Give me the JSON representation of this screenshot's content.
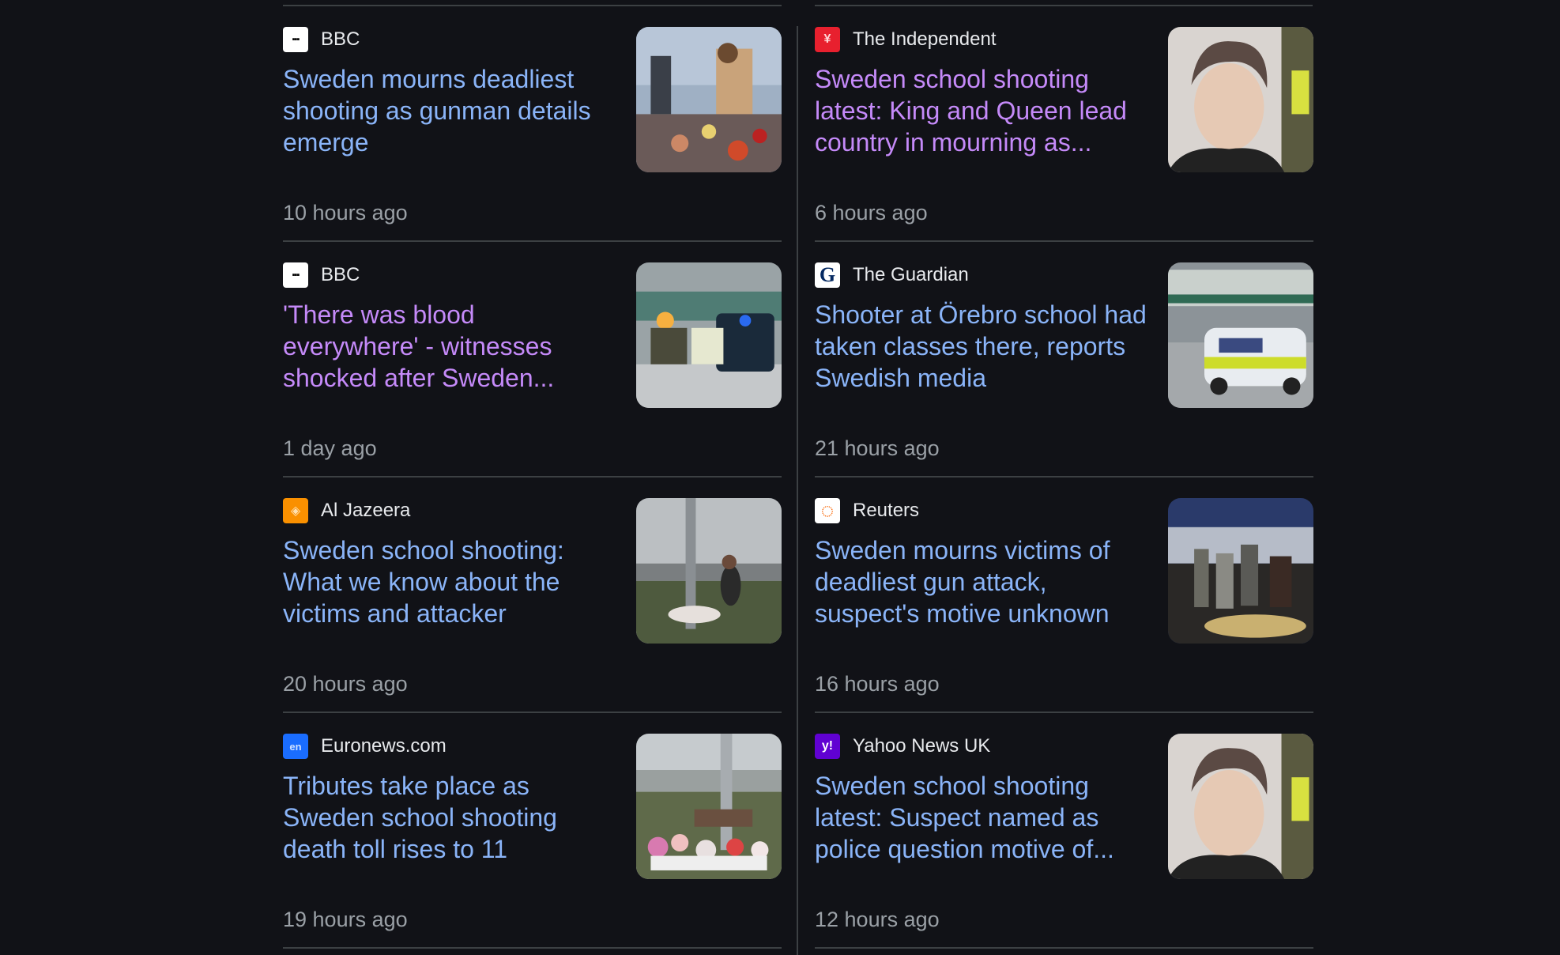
{
  "articles": [
    {
      "source": "BBC",
      "title": "Sweden mourns deadliest shooting as gunman details emerge",
      "time": "10 hours ago",
      "visited": false,
      "logo": "bbc-logo",
      "thumb": "flowers-mourner"
    },
    {
      "source": "The Independent",
      "title": "Sweden school shooting latest: King and Queen lead country in mourning as...",
      "time": "6 hours ago",
      "visited": true,
      "logo": "independent-logo",
      "thumb": "suspect-portrait"
    },
    {
      "source": "BBC",
      "title": "'There was blood everywhere' - witnesses shocked after Sweden...",
      "time": "1 day ago",
      "visited": true,
      "logo": "bbc-logo",
      "thumb": "emergency-scene"
    },
    {
      "source": "The Guardian",
      "title": "Shooter at Örebro school had taken classes there, reports Swedish media",
      "time": "21 hours ago",
      "visited": false,
      "logo": "guardian-logo",
      "thumb": "police-car"
    },
    {
      "source": "Al Jazeera",
      "title": "Sweden school shooting: What we know about the victims and attacker",
      "time": "20 hours ago",
      "visited": false,
      "logo": "aljazeera-logo",
      "thumb": "memorial-pole"
    },
    {
      "source": "Reuters",
      "title": "Sweden mourns victims of deadliest gun attack, suspect's motive unknown",
      "time": "16 hours ago",
      "visited": false,
      "logo": "reuters-logo",
      "thumb": "night-vigil"
    },
    {
      "source": "Euronews.com",
      "title": "Tributes take place as Sweden school shooting death toll rises to 11",
      "time": "19 hours ago",
      "visited": false,
      "logo": "euronews-logo",
      "thumb": "memorial-flowers"
    },
    {
      "source": "Yahoo News UK",
      "title": "Sweden school shooting latest: Suspect named as police question motive of...",
      "time": "12 hours ago",
      "visited": false,
      "logo": "yahoo-logo",
      "thumb": "suspect-portrait"
    }
  ],
  "logos": {
    "bbc-logo": {
      "glyph": "▪▪▪",
      "bg": "#ffffff",
      "fg": "#000000"
    },
    "independent-logo": {
      "glyph": "¥",
      "bg": "#e8202e",
      "fg": "#ffd6d6"
    },
    "guardian-logo": {
      "glyph": "G",
      "bg": "#ffffff",
      "fg": "#052962"
    },
    "aljazeera-logo": {
      "glyph": "◈",
      "bg": "#fa9000",
      "fg": "#ffe0b0"
    },
    "reuters-logo": {
      "glyph": "◌",
      "bg": "#ffffff",
      "fg": "#fa6400"
    },
    "euronews-logo": {
      "glyph": "en",
      "bg": "#1a6dff",
      "fg": "#cfe0ff"
    },
    "yahoo-logo": {
      "glyph": "y!",
      "bg": "#6001d2",
      "fg": "#ffffff"
    }
  },
  "colors": {
    "link": "#8ab4f8",
    "visited": "#c58af9",
    "muted": "#9aa0a6",
    "background": "#111217"
  }
}
